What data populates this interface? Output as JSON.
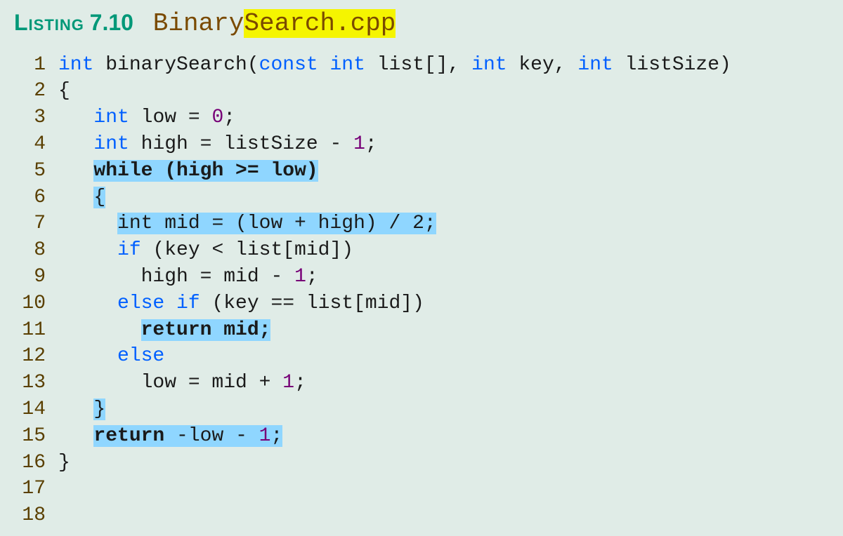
{
  "header": {
    "listing_label": "Listing",
    "listing_number": "7.10",
    "filename_plain": "Binary",
    "filename_highlighted": "Search.cpp"
  },
  "line_numbers": [
    "1",
    "2",
    "3",
    "4",
    "5",
    "6",
    "7",
    "8",
    "9",
    "10",
    "11",
    "12",
    "13",
    "14",
    "15",
    "16",
    "17",
    "18"
  ],
  "code": {
    "l1a": "int",
    "l1b": " binarySearch(",
    "l1c": "const int",
    "l1d": " list[], ",
    "l1e": "int",
    "l1f": " key, ",
    "l1g": "int",
    "l1h": " listSize)",
    "l2": "{",
    "l3a": "   ",
    "l3b": "int",
    "l3c": " low = ",
    "l3d": "0",
    "l3e": ";",
    "l4a": "   ",
    "l4b": "int",
    "l4c": " high = listSize - ",
    "l4d": "1",
    "l4e": ";",
    "l5": "",
    "l6a": "   ",
    "l6b": "while (high >= low)",
    "l7a": "   ",
    "l7b": "{",
    "l8a": "     ",
    "l8b": "int mid = (low + high) / 2;",
    "l9a": "     ",
    "l9b": "if",
    "l9c": " (key < list[mid])",
    "l10a": "       high = mid - ",
    "l10b": "1",
    "l10c": ";",
    "l11a": "     ",
    "l11b": "else if",
    "l11c": " (key == list[mid])",
    "l12a": "       ",
    "l12b": "return mid;",
    "l13a": "     ",
    "l13b": "else",
    "l14a": "       low = mid + ",
    "l14b": "1",
    "l14c": ";",
    "l15a": "   ",
    "l15b": "}",
    "l16": "",
    "l17a": "   ",
    "l17b": "return",
    "l17c": " -low - ",
    "l17d": "1",
    "l17e": ";",
    "l18": "}"
  }
}
